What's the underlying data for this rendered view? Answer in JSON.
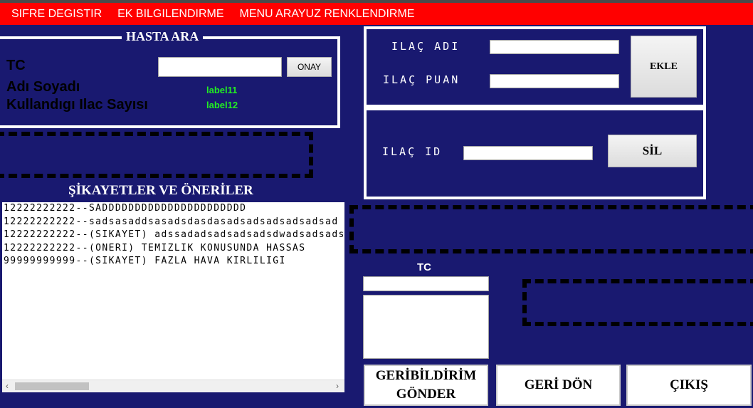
{
  "menu": {
    "items": [
      "SIFRE DEGISTIR",
      "EK BILGILENDIRME",
      "MENU ARAYUZ RENKLENDIRME"
    ]
  },
  "search_panel": {
    "title": "HASTA ARA",
    "tc_label": "TC",
    "name_label": "Adı Soyadı",
    "drug_count_label": "Kullandıgı Ilac Sayısı",
    "tc_value": "",
    "confirm_button": "ONAY",
    "name_value": "label11",
    "drug_count_value": "label12"
  },
  "add_drug_panel": {
    "drug_name_label": "ILAÇ ADI",
    "drug_score_label": "ILAÇ PUAN",
    "drug_name_value": "",
    "drug_score_value": "",
    "add_button": "EKLE"
  },
  "delete_drug_panel": {
    "drug_id_label": "ILAÇ ID",
    "drug_id_value": "",
    "delete_button": "SİL"
  },
  "complaints": {
    "title": "ŞİKAYETLER VE ÖNERİLER",
    "items": [
      "12222222222--SADDDDDDDDDDDDDDDDDDDDDD",
      "12222222222--sadsasaddsasadsdasdasadsadsadsadsadsad",
      "12222222222--(SIKAYET) adssadadsadsadsadsdwadsadsads",
      "12222222222--(ONERI) TEMIZLIK KONUSUNDA HASSAS",
      "99999999999--(SIKAYET) FAZLA HAVA KIRLILIGI"
    ]
  },
  "feedback": {
    "tc_label": "TC",
    "tc_value": "",
    "message_value": "",
    "send_button_line1": "GERİBİLDİRİM",
    "send_button_line2": "GÖNDER"
  },
  "footer": {
    "back_button": "GERİ DÖN",
    "exit_button": "ÇIKIŞ"
  },
  "colors": {
    "background": "#191970",
    "menu_bar": "#ff0000",
    "label_green": "#22ee22"
  }
}
